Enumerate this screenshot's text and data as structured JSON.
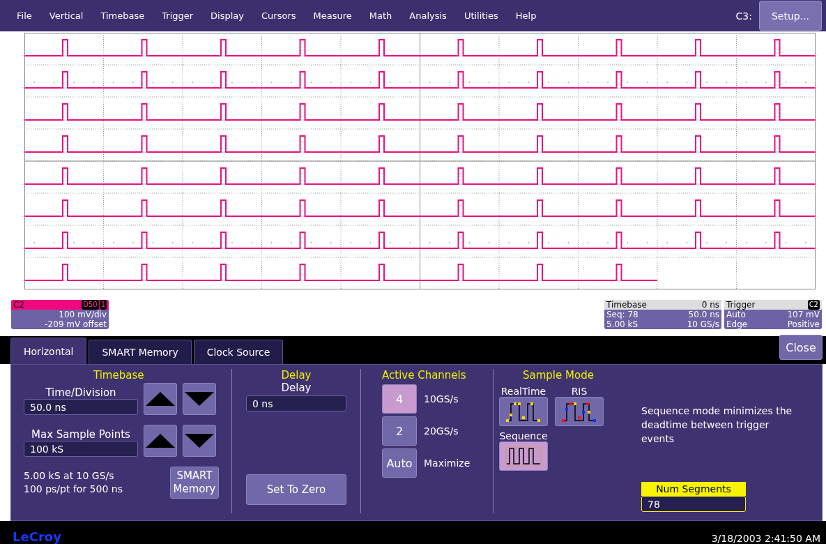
{
  "menu": {
    "items": [
      "File",
      "Vertical",
      "Timebase",
      "Trigger",
      "Display",
      "Cursors",
      "Measure",
      "Math",
      "Analysis",
      "Utilities",
      "Help"
    ],
    "channel": "C3:",
    "setup": "Setup..."
  },
  "channel_box": {
    "name": "C2",
    "badges": [
      "D50",
      "1"
    ],
    "scale": "100 mV/div",
    "offset": "-209 mV offset"
  },
  "timebase_box": {
    "title": "Timebase",
    "value": "0 ns",
    "rows": [
      [
        "Seq: 78",
        "50.0 ns"
      ],
      [
        "5.00 kS",
        "10 GS/s"
      ]
    ]
  },
  "trigger_box": {
    "title": "Trigger",
    "badge": "C2",
    "rows": [
      [
        "Auto",
        "107 mV"
      ],
      [
        "Edge",
        "Positive"
      ]
    ]
  },
  "tabs": [
    {
      "label": "Horizontal",
      "selected": true
    },
    {
      "label": "SMART Memory",
      "selected": false
    },
    {
      "label": "Clock Source",
      "selected": false
    }
  ],
  "close": "Close",
  "timebase": {
    "title": "Timebase",
    "time_division": {
      "label": "Time/Division",
      "value": "50.0 ns"
    },
    "max_sample_points": {
      "label": "Max Sample Points",
      "value": "100 kS"
    },
    "info": [
      "5.00 kS at 10 GS/s",
      "100 ps/pt for 500 ns"
    ],
    "smart_memory": "SMART Memory"
  },
  "delay": {
    "title": "Delay",
    "label": "Delay",
    "value": "0 ns",
    "set_to_zero": "Set To Zero"
  },
  "active_channels": {
    "title": "Active Channels",
    "options": [
      {
        "button": "4",
        "rate": "10GS/s",
        "selected": true
      },
      {
        "button": "2",
        "rate": "20GS/s",
        "selected": false
      },
      {
        "button": "Auto",
        "rate": "Maximize",
        "selected": false
      }
    ]
  },
  "sample_mode": {
    "title": "Sample Mode",
    "modes": [
      {
        "label": "RealTime",
        "kind": "realtime",
        "selected": false
      },
      {
        "label": "RIS",
        "kind": "ris",
        "selected": false
      },
      {
        "label": "Sequence",
        "kind": "sequence",
        "selected": true
      }
    ],
    "description": "Sequence mode minimizes the deadtime between trigger events",
    "num_segments": {
      "label": "Num Segments",
      "value": "78"
    }
  },
  "footer": {
    "logo": "LeCroy",
    "timestamp": "3/18/2003 2:41:50 AM"
  }
}
